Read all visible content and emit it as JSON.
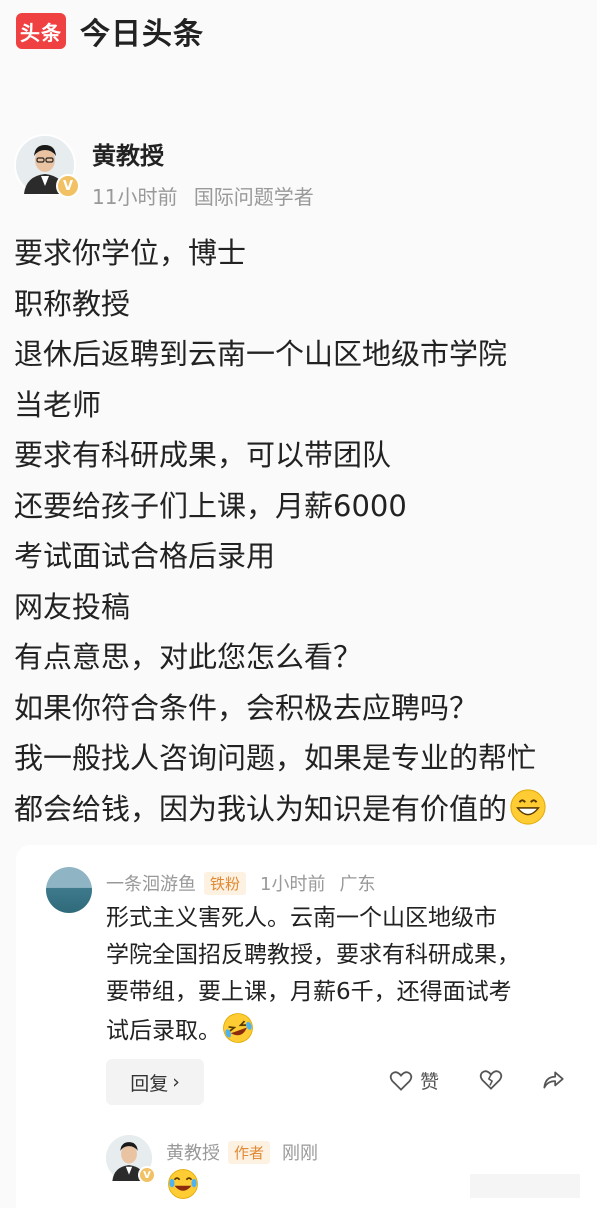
{
  "app": {
    "logo_text": "头条",
    "name": "今日头条",
    "brand_color": "#f04142"
  },
  "author": {
    "name": "黄教授",
    "time": "11小时前",
    "title": "国际问题学者",
    "verified_badge": "V"
  },
  "post": {
    "lines": [
      "要求你学位，博士",
      "职称教授",
      "退休后返聘到云南一个山区地级市学院",
      "当老师",
      "要求有科研成果，可以带团队",
      "还要给孩子们上课，月薪6000",
      "考试面试合格后录用",
      "网友投稿",
      "有点意思，对此您怎么看？",
      "如果你符合条件，会积极去应聘吗？",
      "我一般找人咨询问题，如果是专业的帮忙",
      "都会给钱，因为我认为知识是有价值的"
    ],
    "end_emoji": "grinning-face"
  },
  "comment": {
    "user": "一条洄游鱼",
    "tag": "铁粉",
    "time": "1小时前",
    "location": "广东",
    "lines": [
      "形式主义害死人。云南一个山区地级市",
      "学院全国招反聘教授，要求有科研成果，",
      "要带组，要上课，月薪6千，还得面试考",
      "试后录取。"
    ],
    "end_emoji": "rolling-laughing-face",
    "reply_label": "回复",
    "like_label": "赞"
  },
  "sub_reply": {
    "user": "黄教授",
    "tag": "作者",
    "time": "刚刚",
    "emoji": "tears-of-joy-face"
  }
}
